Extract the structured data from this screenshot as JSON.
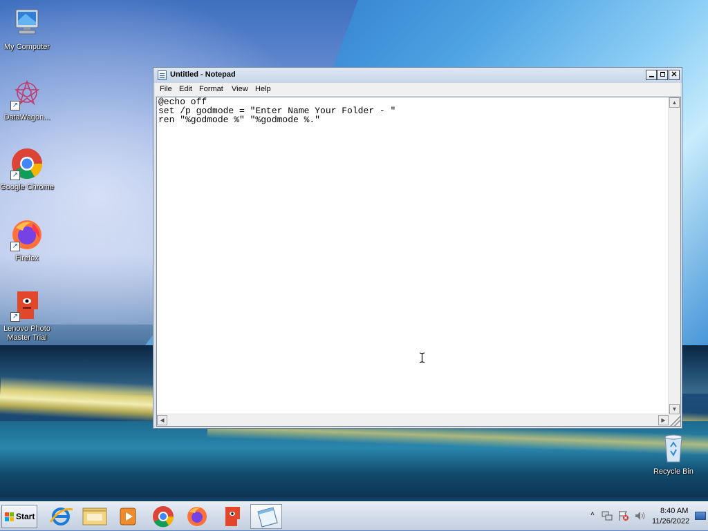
{
  "desktop": {
    "icons": [
      {
        "label": "My Computer"
      },
      {
        "label": "DataWagon..."
      },
      {
        "label": "Google Chrome"
      },
      {
        "label": "Firefox"
      },
      {
        "label": "Lenovo Photo Master Trial"
      },
      {
        "label": "Recycle Bin"
      }
    ]
  },
  "notepad": {
    "title": "Untitled - Notepad",
    "menu": [
      "File",
      "Edit",
      "Format",
      "View",
      "Help"
    ],
    "content": "@echo off\nset /p godmode = \"Enter Name Your Folder - \"\nren \"%godmode %\" \"%godmode %.\""
  },
  "taskbar": {
    "start_label": "Start",
    "clock_time": "8:40 AM",
    "clock_date": "11/26/2022"
  }
}
